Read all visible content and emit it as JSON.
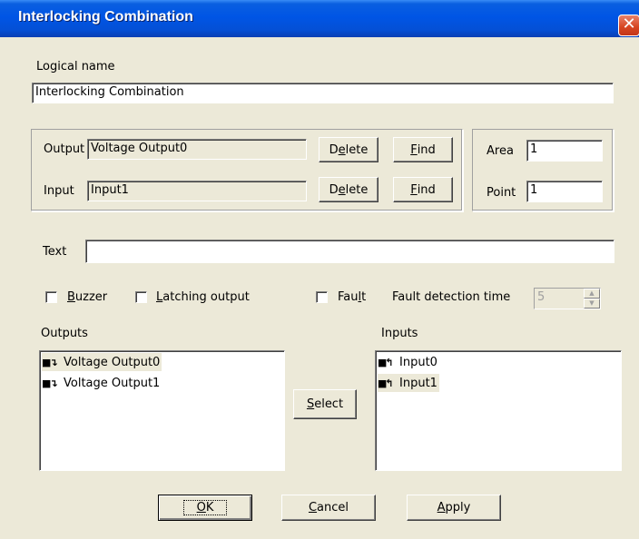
{
  "window": {
    "title": "Interlocking Combination",
    "close_glyph": "✕"
  },
  "logical_name": {
    "label": "Logical name",
    "value": "Interlocking Combination"
  },
  "output_group": {
    "output_label": "Output",
    "output_value": "Voltage Output0",
    "input_label": "Input",
    "input_value": "Input1",
    "delete_prefix": "D",
    "delete_u": "e",
    "delete_suffix": "lete",
    "find_prefix": "",
    "find_u": "F",
    "find_suffix": "ind"
  },
  "area_point": {
    "area_label": "Area",
    "area_value": "1",
    "point_label": "Point",
    "point_value": "1"
  },
  "text": {
    "label": "Text",
    "value": ""
  },
  "options": {
    "buzzer_u": "B",
    "buzzer_rest": "uzzer",
    "latching_u": "L",
    "latching_rest": "atching output",
    "fault_prefix": "Fau",
    "fault_u": "l",
    "fault_suffix": "t",
    "fault_time_label": "Fault detection time",
    "fault_time_value": "5"
  },
  "outputs": {
    "label": "Outputs",
    "items": [
      "Voltage Output0",
      "Voltage Output1"
    ],
    "icon": "output-arrow-icon"
  },
  "inputs": {
    "label": "Inputs",
    "items": [
      "Input0",
      "Input1"
    ],
    "icon": "input-arrow-icon"
  },
  "select": {
    "u": "S",
    "rest": "elect"
  },
  "footer": {
    "ok_u": "O",
    "ok_rest": "K",
    "cancel_u": "C",
    "cancel_rest": "ancel",
    "apply_u": "A",
    "apply_rest": "pply"
  },
  "colors": {
    "title_bar": "#0055e5",
    "dialog_bg": "#ece9d8",
    "close_button": "#d6441f"
  }
}
